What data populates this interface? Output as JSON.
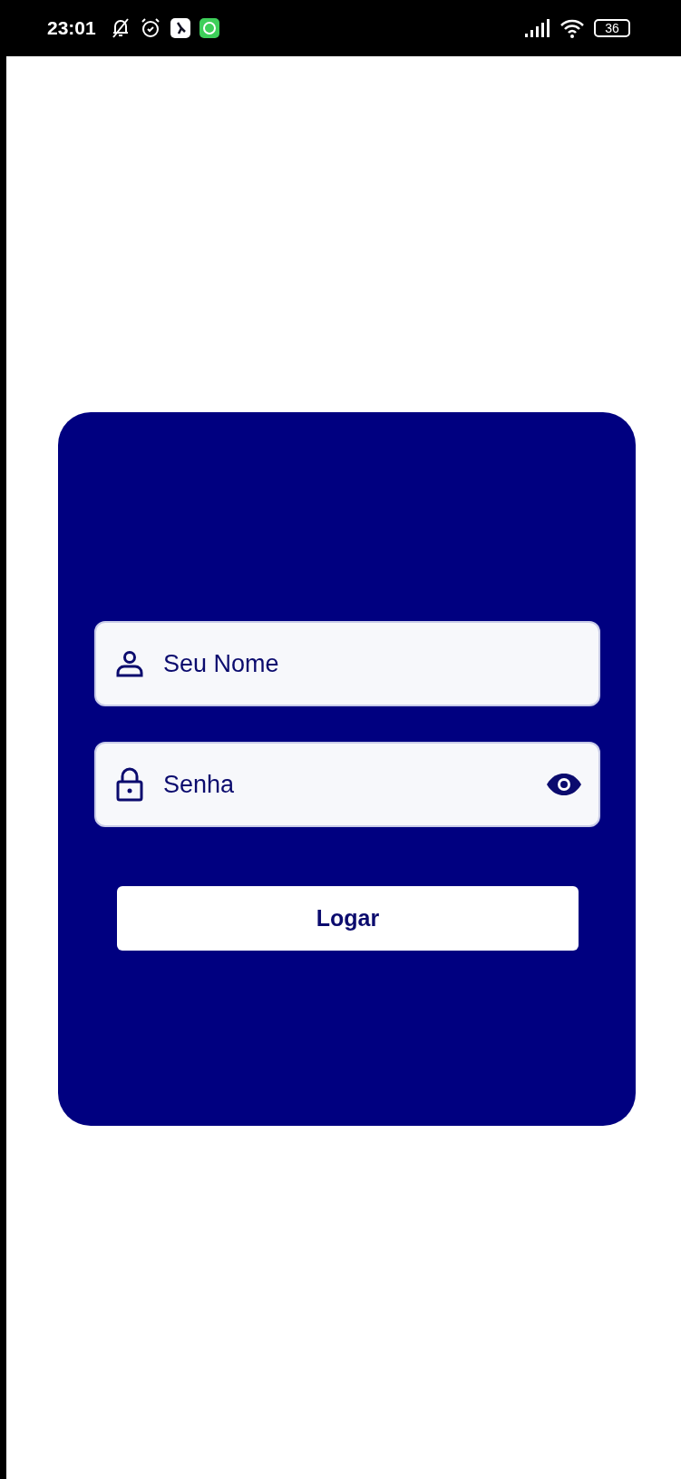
{
  "status_bar": {
    "time": "23:01",
    "battery": "36"
  },
  "login": {
    "fields": [
      {
        "kind": "text",
        "placeholder": "Seu Nome"
      },
      {
        "kind": "password",
        "placeholder": "Senha"
      }
    ],
    "button": "Logar"
  }
}
